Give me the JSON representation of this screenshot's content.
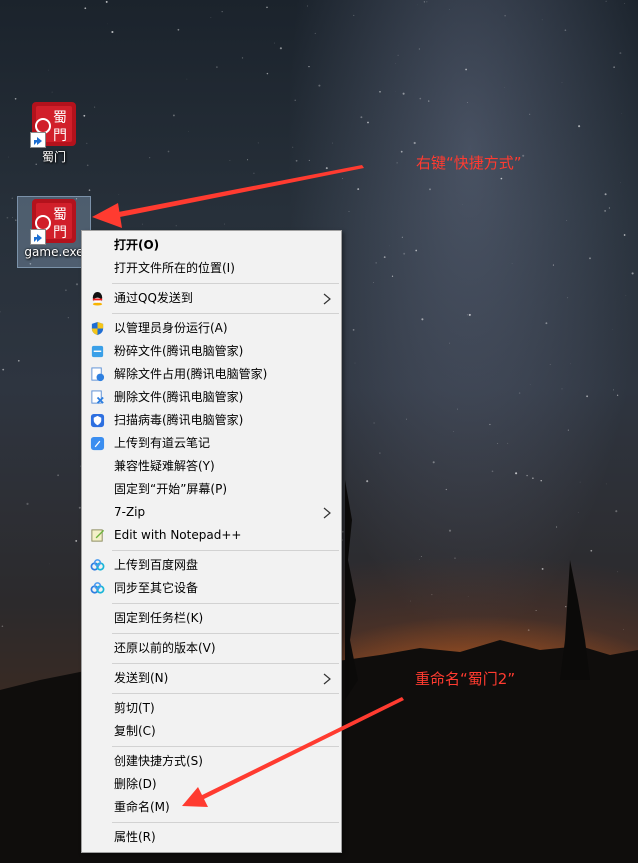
{
  "desktop_icons": [
    {
      "label": "蜀门",
      "icon": "game-logo-icon",
      "selected": false
    },
    {
      "label": "game.exe",
      "icon": "game-logo-icon",
      "selected": true
    }
  ],
  "context_menu": {
    "items": [
      {
        "label": "打开(O)",
        "bold": true
      },
      {
        "label": "打开文件所在的位置(I)"
      },
      {
        "sep": true
      },
      {
        "label": "通过QQ发送到",
        "icon": "qq-icon",
        "submenu": true
      },
      {
        "sep": true
      },
      {
        "label": "以管理员身份运行(A)",
        "icon": "uac-shield-icon"
      },
      {
        "label": "粉碎文件(腾讯电脑管家)",
        "icon": "shred-icon"
      },
      {
        "label": "解除文件占用(腾讯电脑管家)",
        "icon": "unlock-file-icon"
      },
      {
        "label": "删除文件(腾讯电脑管家)",
        "icon": "delete-file-icon"
      },
      {
        "label": "扫描病毒(腾讯电脑管家)",
        "icon": "scan-virus-icon"
      },
      {
        "label": "上传到有道云笔记",
        "icon": "youdao-icon"
      },
      {
        "label": "兼容性疑难解答(Y)"
      },
      {
        "label": "固定到“开始”屏幕(P)"
      },
      {
        "label": "7-Zip",
        "submenu": true
      },
      {
        "label": "Edit with Notepad++",
        "icon": "notepad-plus-icon"
      },
      {
        "sep": true
      },
      {
        "label": "上传到百度网盘",
        "icon": "baidu-cloud-icon"
      },
      {
        "label": "同步至其它设备",
        "icon": "baidu-sync-icon"
      },
      {
        "sep": true
      },
      {
        "label": "固定到任务栏(K)"
      },
      {
        "sep": true
      },
      {
        "label": "还原以前的版本(V)"
      },
      {
        "sep": true
      },
      {
        "label": "发送到(N)",
        "submenu": true
      },
      {
        "sep": true
      },
      {
        "label": "剪切(T)"
      },
      {
        "label": "复制(C)"
      },
      {
        "sep": true
      },
      {
        "label": "创建快捷方式(S)"
      },
      {
        "label": "删除(D)"
      },
      {
        "label": "重命名(M)"
      },
      {
        "sep": true
      },
      {
        "label": "属性(R)"
      }
    ]
  },
  "annotations": {
    "shortcut_note": "右键“快捷方式”",
    "rename_note": "重命名“蜀门2”",
    "color": "#ff3b30"
  }
}
